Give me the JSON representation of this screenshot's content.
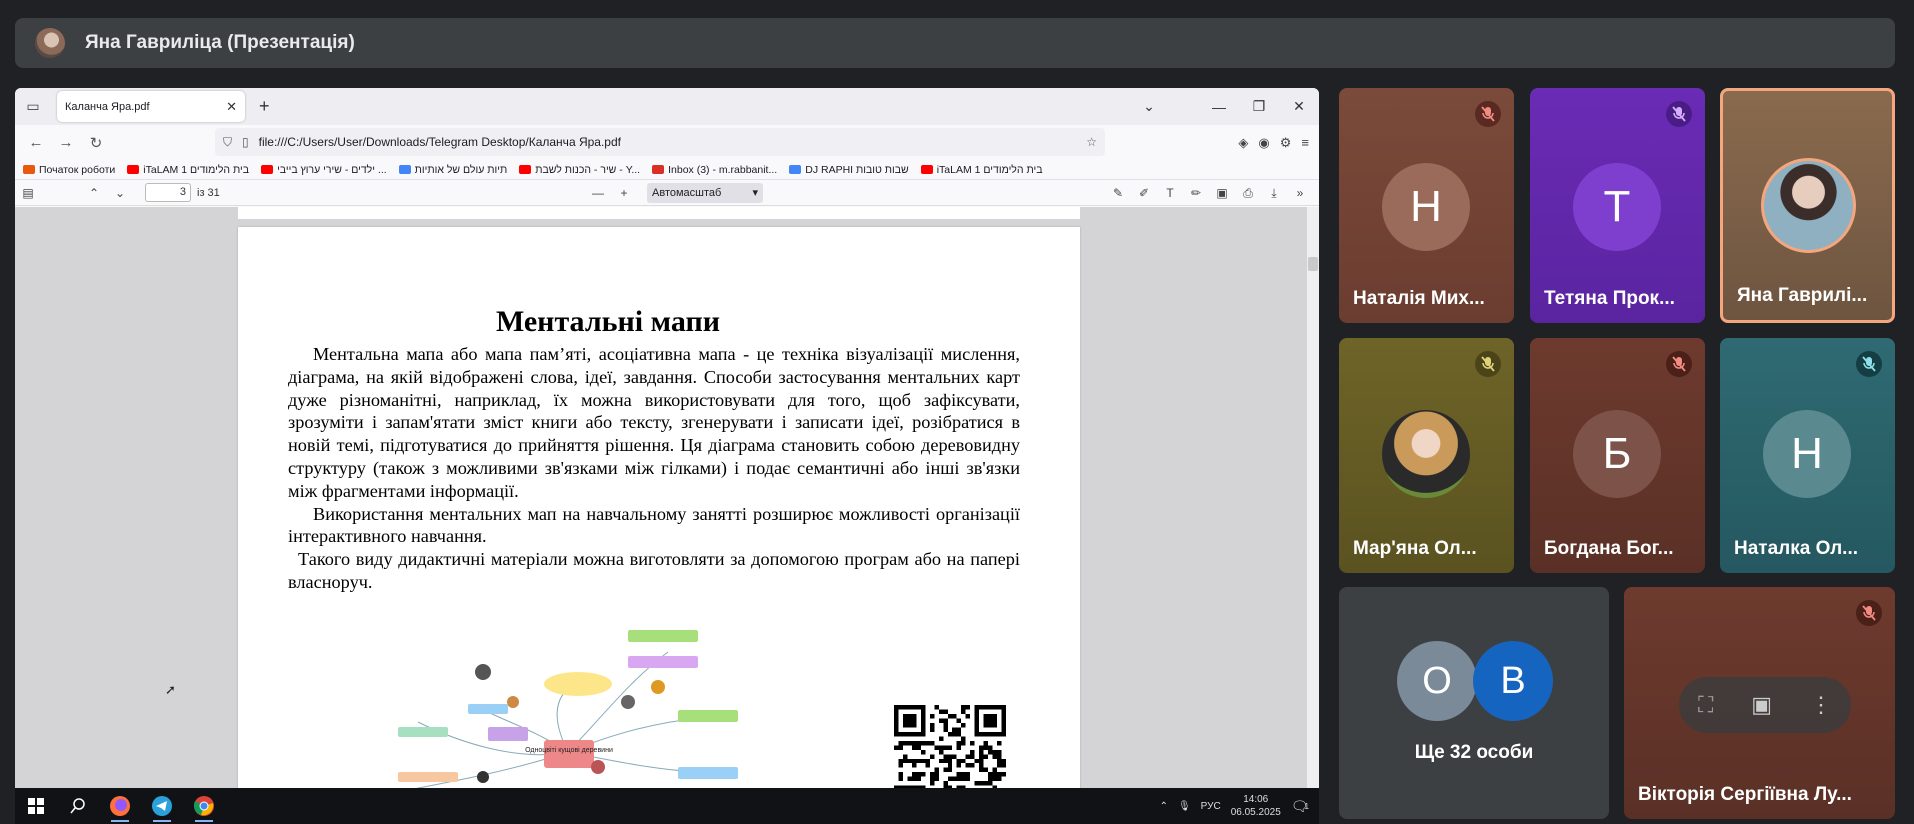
{
  "presenter": {
    "title": "Яна Гавриліца (Презентація)"
  },
  "browser": {
    "tab_title": "Каланча Яра.pdf",
    "new_tab": "+",
    "url": "file:///C:/Users/User/Downloads/Telegram Desktop/Каланча Яра.pdf",
    "bookmarks": [
      {
        "label": "Початок роботи",
        "color": "#e8590c"
      },
      {
        "label": "iTaLAM 1 בית הלימודים",
        "color": "#ff0000"
      },
      {
        "label": "ילדים - שירי ערוץ בייבי ...",
        "color": "#ff0000"
      },
      {
        "label": "תיות עולם של אותיות",
        "color": "#4285f4"
      },
      {
        "label": "שיר - הכנות לשבת - Y...",
        "color": "#ff0000"
      },
      {
        "label": "Inbox (3) - m.rabbanit...",
        "color": "#d93025"
      },
      {
        "label": "DJ RAPHI שבות טובות",
        "color": "#4285f4"
      },
      {
        "label": "iTaLAM 1 בית הלימודים",
        "color": "#ff0000"
      }
    ]
  },
  "pdf": {
    "current_page": "3",
    "page_of": "із 31",
    "zoom": "Автомасштаб",
    "title": "Ментальні мапи",
    "paragraphs": [
      "Ментальна мапа або мапа пам’яті, асоціативна мапа  - це техніка візуалізації мислення, діаграма, на якій відображені слова, ідеї, завдання.  Способи застосування ментальних карт дуже  різноманітні, наприклад, їх можна використовувати для того, щоб зафіксувати, зрозуміти і запам'ятати зміст книги або тексту, згенерувати і записати ідеї, розібратися в новій темі, підготуватися до прийняття рішення. Ця діаграма становить собою деревовидну структуру (також з можливими зв'язками між гілками) і подає семантичні або інші зв'язки між фрагментами інформації.",
      "Використання ментальних мап на навчальному занятті розширює можливості організації інтерактивного навчання.",
      "Такого виду дидактичні матеріали можна виготовляти за допомогою програм або на папері власноруч."
    ],
    "mindmap_center": "Одноцвіті кущові деревини"
  },
  "taskbar": {
    "lang": "РУС",
    "time": "14:06",
    "date": "06.05.2025",
    "notif_count": "1"
  },
  "participants": [
    {
      "name": "Наталія Мих...",
      "letter": "Н",
      "muted": true
    },
    {
      "name": "Тетяна Прок...",
      "letter": "Т",
      "muted": true
    },
    {
      "name": "Яна Гаврилі...",
      "muted": false
    },
    {
      "name": "Мар'яна Ол...",
      "muted": true
    },
    {
      "name": "Богдана Бог...",
      "letter": "Б",
      "muted": true
    },
    {
      "name": "Наталка Ол...",
      "letter": "Н",
      "muted": true
    },
    {
      "name": "Ще 32 особи",
      "letters": [
        "О",
        "В"
      ]
    },
    {
      "name": "Вікторія Сергіївна Лу...",
      "muted": true
    }
  ]
}
